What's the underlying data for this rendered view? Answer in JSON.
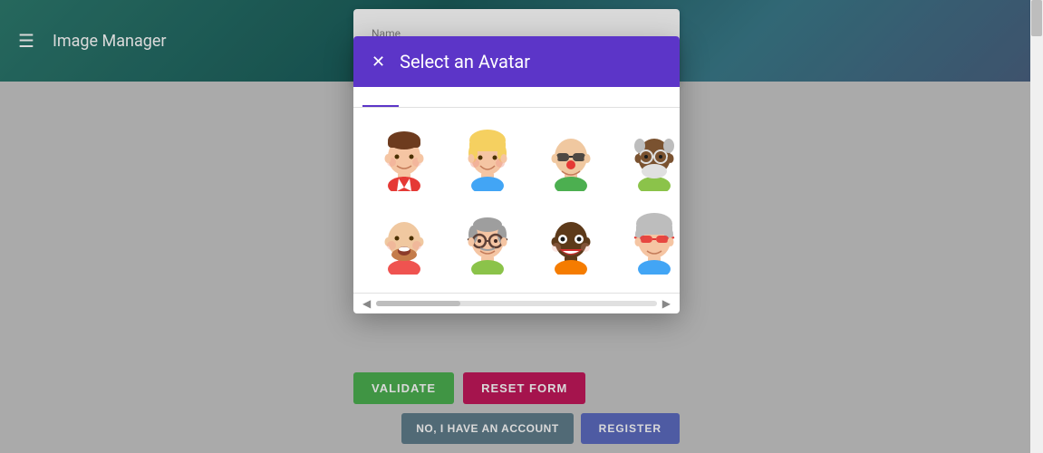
{
  "app": {
    "title": "Image Manager"
  },
  "header": {
    "menu_icon": "☰"
  },
  "form": {
    "name_label": "Name",
    "validate_btn": "VALIDATE",
    "reset_btn": "RESET FORM",
    "no_account_btn": "NO, I HAVE AN ACCOUNT",
    "register_btn": "REGISTER"
  },
  "modal": {
    "title": "Select an Avatar",
    "close_icon": "✕",
    "tabs": [
      "",
      "",
      "",
      ""
    ],
    "avatars": [
      {
        "id": "avatar-1",
        "description": "young man brown hair"
      },
      {
        "id": "avatar-2",
        "description": "young person blonde hair"
      },
      {
        "id": "avatar-3",
        "description": "bald man red nose sunglasses"
      },
      {
        "id": "avatar-4",
        "description": "dark skin man glasses white beard"
      },
      {
        "id": "avatar-5",
        "description": "bald man beard open mouth"
      },
      {
        "id": "avatar-6",
        "description": "older man round glasses gray hair"
      },
      {
        "id": "avatar-7",
        "description": "dark skin bald man"
      },
      {
        "id": "avatar-8",
        "description": "older woman red sunglasses gray hair"
      }
    ]
  }
}
